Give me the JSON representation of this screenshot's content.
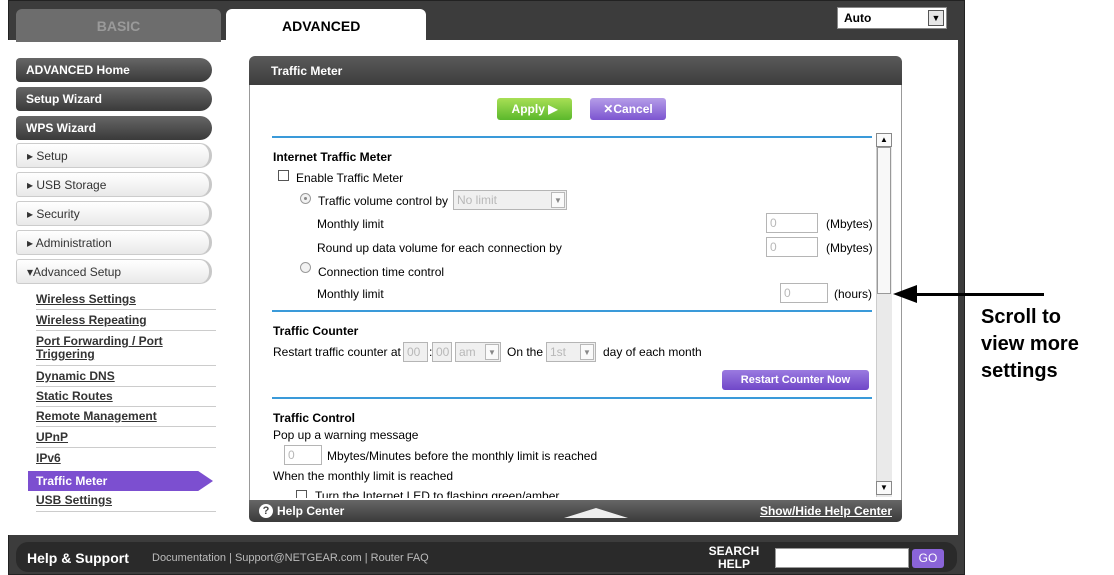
{
  "tabs": {
    "basic": "BASIC",
    "advanced": "ADVANCED"
  },
  "language": {
    "value": "Auto"
  },
  "sidebar": {
    "dark": [
      "ADVANCED Home",
      "Setup Wizard",
      "WPS Wizard"
    ],
    "light": [
      "▸ Setup",
      "▸ USB Storage",
      "▸ Security",
      "▸ Administration",
      "▾Advanced Setup"
    ],
    "links": [
      "Wireless Settings",
      "Wireless Repeating",
      "Port Forwarding / Port Triggering",
      "Dynamic DNS",
      "Static Routes",
      "Remote Management",
      "UPnP",
      "IPv6",
      "Traffic Meter",
      "USB Settings"
    ]
  },
  "panel": {
    "title": "Traffic Meter",
    "apply": "Apply ▶",
    "cancel": "✕Cancel",
    "itm": {
      "heading": "Internet Traffic Meter",
      "enable": "Enable Traffic Meter",
      "volume_control": "Traffic volume control by",
      "volume_select": "No limit",
      "monthly_limit": "Monthly limit",
      "monthly_value": "0",
      "mbytes": "(Mbytes)",
      "round_up": "Round up data volume for each connection by",
      "round_value": "0",
      "conn_time": "Connection time control",
      "monthly_limit2": "Monthly limit",
      "hours_value": "0",
      "hours": "(hours)"
    },
    "counter": {
      "heading": "Traffic Counter",
      "restart_at": "Restart traffic counter at",
      "hh": "00",
      "mm": "00",
      "colon": ":",
      "ampm": "am",
      "on_the": "On the",
      "day": "1st",
      "day_suffix": "day of each month",
      "restart_btn": "Restart Counter Now"
    },
    "control": {
      "heading": "Traffic Control",
      "popup": "Pop up a warning message",
      "warn_value": "0",
      "warn_suffix": "Mbytes/Minutes before the monthly limit is reached",
      "when": "When the monthly limit is reached",
      "led": "Turn the Internet LED to flashing green/amber"
    },
    "help_center": "Help Center",
    "show_hide": "Show/Hide Help Center"
  },
  "bottom": {
    "help": "Help & Support",
    "links": "Documentation | Support@NETGEAR.com | Router FAQ",
    "search": "SEARCH HELP",
    "go": "GO"
  },
  "annotation": {
    "line1": "Scroll to",
    "line2": "view more",
    "line3": "settings"
  }
}
